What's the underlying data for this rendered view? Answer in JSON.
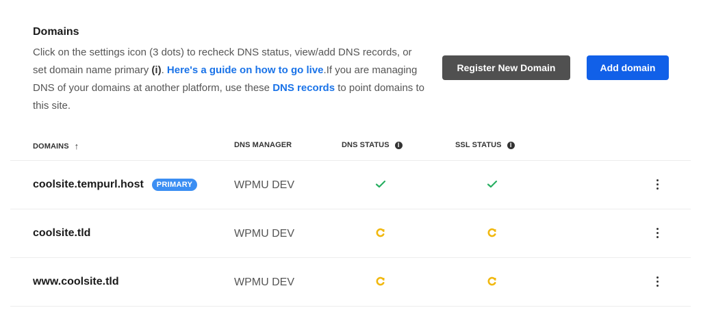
{
  "header": {
    "title": "Domains",
    "desc_part1": "Click on the settings icon (3 dots) to recheck DNS status, view/add DNS records, or set domain name primary ",
    "desc_bold": "(i)",
    "desc_part2": ". ",
    "guide_link": "Here's a guide on how to go live",
    "desc_part3": ".If you are managing DNS of your domains at another platform, use these ",
    "dns_link": "DNS records",
    "desc_part4": " to point domains to this site."
  },
  "buttons": {
    "register": "Register New Domain",
    "add": "Add domain"
  },
  "columns": {
    "domains": "DOMAINS",
    "manager": "DNS MANAGER",
    "dns_status": "DNS STATUS",
    "ssl_status": "SSL STATUS",
    "info_glyph": "i",
    "sort_arrow": "↑"
  },
  "rows": [
    {
      "domain": "coolsite.tempurl.host",
      "badge": "PRIMARY",
      "manager": "WPMU DEV",
      "dns_status": "ok",
      "ssl_status": "ok"
    },
    {
      "domain": "coolsite.tld",
      "manager": "WPMU DEV",
      "dns_status": "pending",
      "ssl_status": "pending"
    },
    {
      "domain": "www.coolsite.tld",
      "manager": "WPMU DEV",
      "dns_status": "pending",
      "ssl_status": "pending"
    }
  ],
  "colors": {
    "ok": "#27ae60",
    "pending": "#f1b80f",
    "link": "#1a73e8",
    "primary_btn": "#1160e8",
    "secondary_btn": "#505050",
    "badge": "#3b8ef3"
  },
  "icons": {
    "ok": "check-icon",
    "pending": "refresh-icon",
    "menu": "more-vertical-icon",
    "info": "info-icon",
    "sort": "arrow-up-icon"
  }
}
